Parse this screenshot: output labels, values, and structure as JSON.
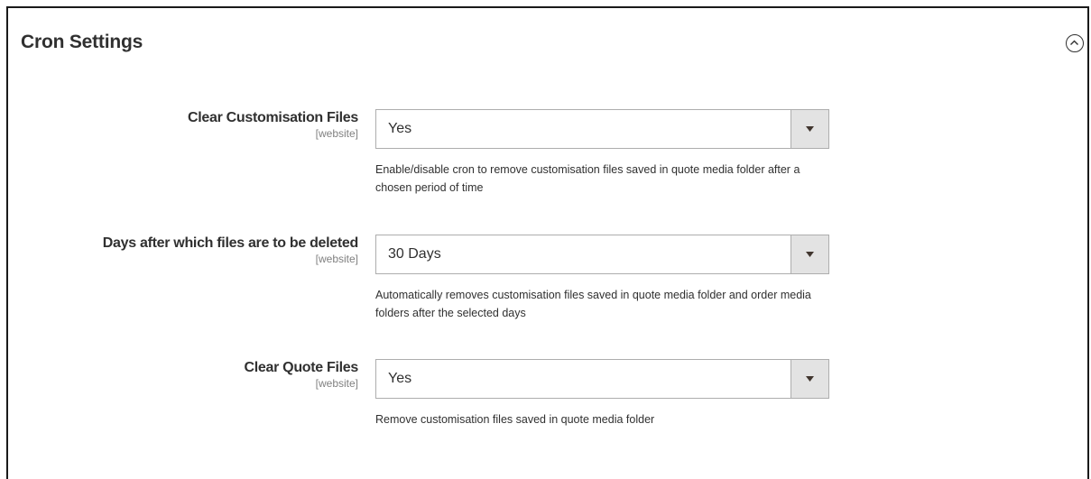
{
  "section": {
    "title": "Cron Settings",
    "toggle_icon": "chevron-up-circle-icon"
  },
  "fields": [
    {
      "label": "Clear Customisation Files",
      "scope": "[website]",
      "value": "Yes",
      "note": "Enable/disable cron to remove customisation files saved in quote media folder after a chosen period of time"
    },
    {
      "label": "Days after which files are to be deleted",
      "scope": "[website]",
      "value": "30 Days",
      "note": "Automatically removes customisation files saved in quote media folder and order media folders after the selected days"
    },
    {
      "label": "Clear Quote Files",
      "scope": "[website]",
      "value": "Yes",
      "note": "Remove customisation files saved in quote media folder"
    }
  ],
  "colors": {
    "text": "#303030",
    "scope_text": "#808080",
    "select_border": "#adadad",
    "select_arrow_bg": "#e3e3e3",
    "panel_border": "#1a1a1a"
  }
}
